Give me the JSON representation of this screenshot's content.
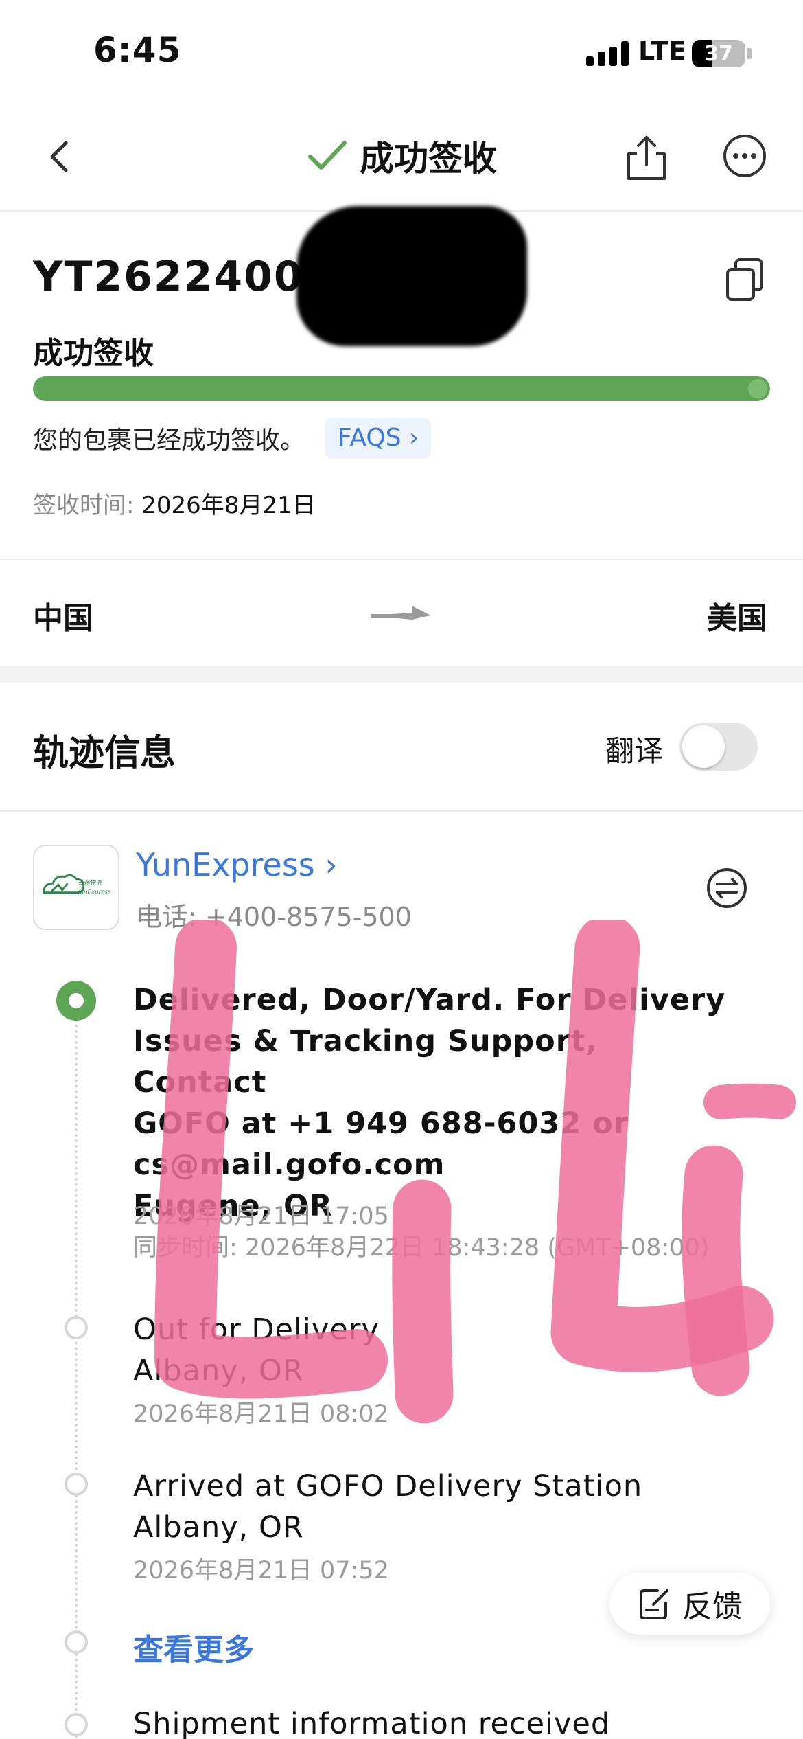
{
  "status_bar": {
    "time": "6:45",
    "network": "LTE",
    "battery": "37",
    "battery_level": 0.37
  },
  "nav": {
    "title": "成功签收"
  },
  "shipment": {
    "tracking_number": "YT26224007",
    "status": "成功签收",
    "progress": 1.0,
    "description": "您的包裹已经成功签收。",
    "faqs_label": "FAQS ›",
    "sign_time_label": "签收时间:",
    "sign_time_value": "2026年8月21日"
  },
  "route": {
    "from": "中国",
    "to": "美国"
  },
  "tracking": {
    "section_title": "轨迹信息",
    "translate_label": "翻译",
    "translate_on": false,
    "carrier": {
      "name": "YunExpress ›",
      "phone": "电话: +400-8575-500",
      "logo_text": "云途物流",
      "logo_subtext": "YunExpress"
    },
    "events": [
      {
        "lines": [
          "Delivered, Door/Yard. For Delivery",
          "Issues & Tracking Support, Contact",
          "GOFO at +1 949 688-6032 or",
          "cs@mail.gofo.com",
          "Eugene, OR"
        ],
        "time": "2026年8月21日 17:05",
        "sync": "同步时间: 2026年8月22日 18:43:28 (GMT+08:00)"
      },
      {
        "lines": [
          "Out for Delivery",
          "Albany, OR"
        ],
        "time": "2026年8月21日 08:02"
      },
      {
        "lines": [
          "Arrived at GOFO Delivery Station",
          "Albany, OR"
        ],
        "time": "2026年8月21日 07:52"
      },
      {
        "lines": [
          "Shipment information received"
        ]
      }
    ],
    "see_more": "查看更多"
  },
  "feedback": {
    "label": "反馈"
  },
  "watermark": {
    "text": "LiLi",
    "color": "#ee6e9b"
  },
  "colors": {
    "accent_green": "#5fa556",
    "link_blue": "#3b77e0"
  }
}
